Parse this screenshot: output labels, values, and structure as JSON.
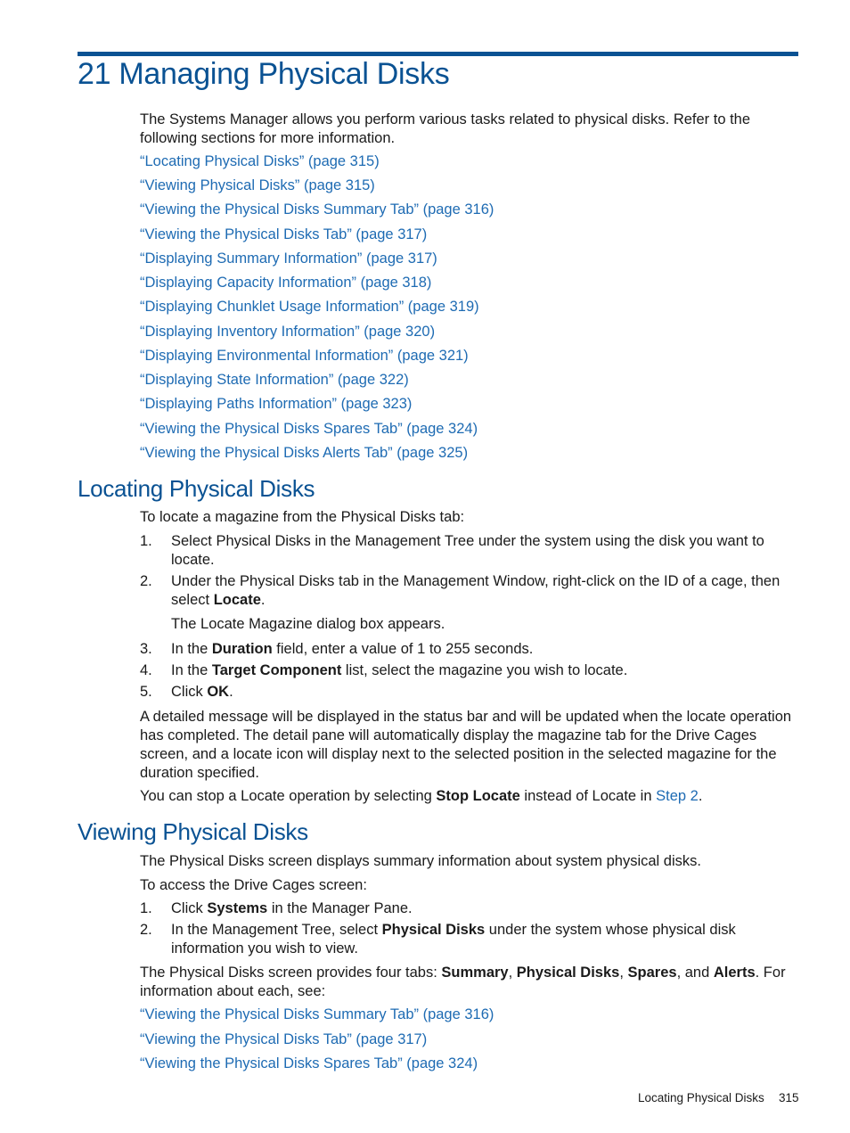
{
  "chapter": {
    "title": "21 Managing Physical Disks",
    "intro": "The Systems Manager allows you perform various tasks related to physical disks. Refer to the following sections for more information.",
    "links": [
      "“Locating Physical Disks” (page 315)",
      "“Viewing Physical Disks” (page 315)",
      "“Viewing the Physical Disks Summary Tab” (page 316)",
      "“Viewing the Physical Disks Tab” (page 317)",
      "“Displaying Summary Information” (page 317)",
      "“Displaying Capacity Information” (page 318)",
      "“Displaying Chunklet Usage Information” (page 319)",
      "“Displaying Inventory Information” (page 320)",
      "“Displaying Environmental Information” (page 321)",
      "“Displaying State Information” (page 322)",
      "“Displaying Paths Information” (page 323)",
      "“Viewing the Physical Disks Spares Tab” (page 324)",
      "“Viewing the Physical Disks Alerts Tab” (page 325)"
    ]
  },
  "locating": {
    "heading": "Locating Physical Disks",
    "intro": "To locate a magazine from the Physical Disks tab:",
    "steps": [
      {
        "num": "1.",
        "text": "Select Physical Disks in the Management Tree under the system using the disk you want to locate."
      },
      {
        "num": "2.",
        "pre": "Under the Physical Disks tab in the Management Window, right-click on the ID of a cage, then select ",
        "bold": "Locate",
        "post": "."
      },
      {
        "num": "3.",
        "pre": "In the ",
        "bold": "Duration",
        "post": " field, enter a value of 1 to 255 seconds."
      },
      {
        "num": "4.",
        "pre": "In the ",
        "bold": "Target Component",
        "post": " list, select the magazine you wish to locate."
      },
      {
        "num": "5.",
        "pre": "Click ",
        "bold": "OK",
        "post": "."
      }
    ],
    "step2_note": "The Locate Magazine dialog box appears.",
    "para1": "A detailed message will be displayed in the status bar and will be updated when the locate operation has completed. The detail pane will automatically display the magazine tab for the Drive Cages screen, and a locate icon will display next to the selected position in the selected magazine for the duration specified.",
    "para2_pre": "You can stop a Locate operation by selecting ",
    "para2_bold": "Stop Locate",
    "para2_mid": " instead of Locate in ",
    "para2_link": "Step 2",
    "para2_post": "."
  },
  "viewing": {
    "heading": "Viewing Physical Disks",
    "intro": "The Physical Disks screen displays summary information about system physical disks.",
    "access": "To access the Drive Cages screen:",
    "steps": [
      {
        "num": "1.",
        "pre": "Click ",
        "bold": "Systems",
        "post": " in the Manager Pane."
      },
      {
        "num": "2.",
        "pre": "In the Management Tree, select ",
        "bold": "Physical Disks",
        "post": " under the system whose physical disk information you wish to view."
      }
    ],
    "tabs_pre": "The Physical Disks screen provides four tabs: ",
    "tabs": [
      "Summary",
      "Physical Disks",
      "Spares",
      "Alerts"
    ],
    "tabs_sep1": ", ",
    "tabs_sep2": ", ",
    "tabs_sep3": ", and ",
    "tabs_post": ". For information about each, see:",
    "links": [
      "“Viewing the Physical Disks Summary Tab” (page 316)",
      "“Viewing the Physical Disks Tab” (page 317)",
      "“Viewing the Physical Disks Spares Tab” (page 324)"
    ]
  },
  "footer": {
    "section": "Locating Physical Disks",
    "page": "315"
  }
}
